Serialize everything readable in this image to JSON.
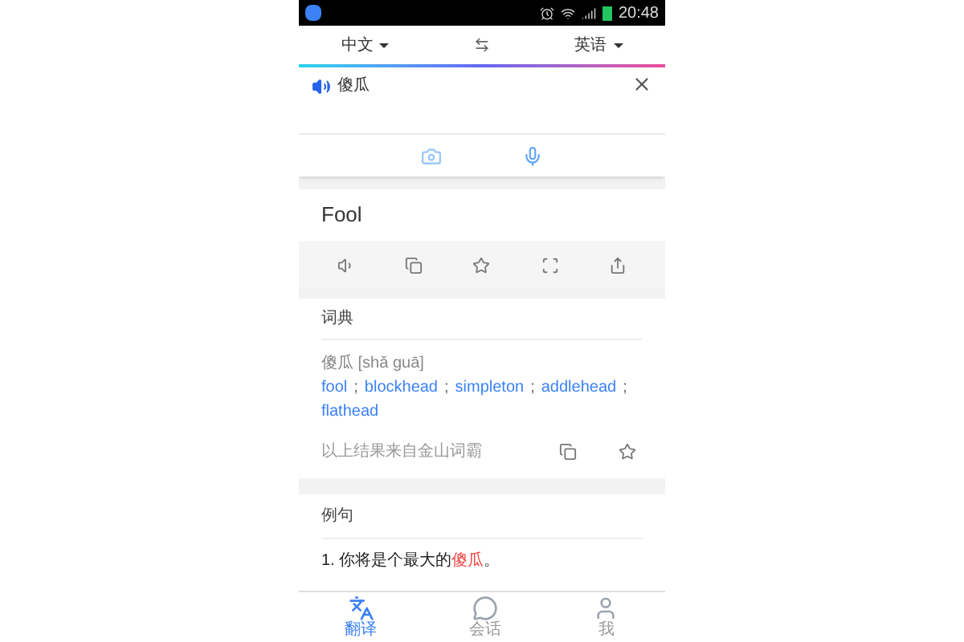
{
  "status_bar": {
    "time": "20:48"
  },
  "languages": {
    "source": "中文",
    "target": "英语"
  },
  "input": {
    "value": "傻瓜"
  },
  "result": {
    "word": "Fool"
  },
  "dictionary": {
    "title": "词典",
    "pronunciation": "傻瓜 [shǎ guā]",
    "translations": [
      {
        "text": "fool",
        "separator": " ;"
      },
      {
        "text": "blockhead",
        "separator": " ;"
      },
      {
        "text": "simpleton",
        "separator": " ;"
      },
      {
        "text": "addlehead",
        "separator": " ;"
      },
      {
        "text": "flathead"
      }
    ],
    "source": "以上结果来自金山词霸"
  },
  "examples": {
    "title": "例句",
    "items": [
      {
        "number": "1.",
        "before": "你将是个最大的",
        "highlight": "傻瓜",
        "after": "。"
      }
    ]
  },
  "bottom_nav": [
    {
      "label": "翻译",
      "selected": true,
      "kind": "translate"
    },
    {
      "label": "会话",
      "selected": false,
      "kind": "chat"
    },
    {
      "label": "我",
      "selected": false,
      "kind": "profile"
    }
  ]
}
